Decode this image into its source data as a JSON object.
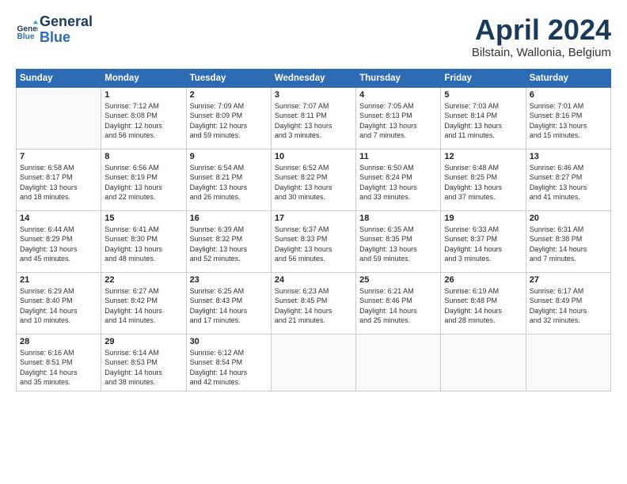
{
  "header": {
    "logo_line1": "General",
    "logo_line2": "Blue",
    "month_title": "April 2024",
    "subtitle": "Bilstain, Wallonia, Belgium"
  },
  "days_of_week": [
    "Sunday",
    "Monday",
    "Tuesday",
    "Wednesday",
    "Thursday",
    "Friday",
    "Saturday"
  ],
  "weeks": [
    [
      {
        "day": "",
        "info": ""
      },
      {
        "day": "1",
        "info": "Sunrise: 7:12 AM\nSunset: 8:08 PM\nDaylight: 12 hours\nand 56 minutes."
      },
      {
        "day": "2",
        "info": "Sunrise: 7:09 AM\nSunset: 8:09 PM\nDaylight: 12 hours\nand 59 minutes."
      },
      {
        "day": "3",
        "info": "Sunrise: 7:07 AM\nSunset: 8:11 PM\nDaylight: 13 hours\nand 3 minutes."
      },
      {
        "day": "4",
        "info": "Sunrise: 7:05 AM\nSunset: 8:13 PM\nDaylight: 13 hours\nand 7 minutes."
      },
      {
        "day": "5",
        "info": "Sunrise: 7:03 AM\nSunset: 8:14 PM\nDaylight: 13 hours\nand 11 minutes."
      },
      {
        "day": "6",
        "info": "Sunrise: 7:01 AM\nSunset: 8:16 PM\nDaylight: 13 hours\nand 15 minutes."
      }
    ],
    [
      {
        "day": "7",
        "info": "Sunrise: 6:58 AM\nSunset: 8:17 PM\nDaylight: 13 hours\nand 18 minutes."
      },
      {
        "day": "8",
        "info": "Sunrise: 6:56 AM\nSunset: 8:19 PM\nDaylight: 13 hours\nand 22 minutes."
      },
      {
        "day": "9",
        "info": "Sunrise: 6:54 AM\nSunset: 8:21 PM\nDaylight: 13 hours\nand 26 minutes."
      },
      {
        "day": "10",
        "info": "Sunrise: 6:52 AM\nSunset: 8:22 PM\nDaylight: 13 hours\nand 30 minutes."
      },
      {
        "day": "11",
        "info": "Sunrise: 6:50 AM\nSunset: 8:24 PM\nDaylight: 13 hours\nand 33 minutes."
      },
      {
        "day": "12",
        "info": "Sunrise: 6:48 AM\nSunset: 8:25 PM\nDaylight: 13 hours\nand 37 minutes."
      },
      {
        "day": "13",
        "info": "Sunrise: 6:46 AM\nSunset: 8:27 PM\nDaylight: 13 hours\nand 41 minutes."
      }
    ],
    [
      {
        "day": "14",
        "info": "Sunrise: 6:44 AM\nSunset: 8:29 PM\nDaylight: 13 hours\nand 45 minutes."
      },
      {
        "day": "15",
        "info": "Sunrise: 6:41 AM\nSunset: 8:30 PM\nDaylight: 13 hours\nand 48 minutes."
      },
      {
        "day": "16",
        "info": "Sunrise: 6:39 AM\nSunset: 8:32 PM\nDaylight: 13 hours\nand 52 minutes."
      },
      {
        "day": "17",
        "info": "Sunrise: 6:37 AM\nSunset: 8:33 PM\nDaylight: 13 hours\nand 56 minutes."
      },
      {
        "day": "18",
        "info": "Sunrise: 6:35 AM\nSunset: 8:35 PM\nDaylight: 13 hours\nand 59 minutes."
      },
      {
        "day": "19",
        "info": "Sunrise: 6:33 AM\nSunset: 8:37 PM\nDaylight: 14 hours\nand 3 minutes."
      },
      {
        "day": "20",
        "info": "Sunrise: 6:31 AM\nSunset: 8:38 PM\nDaylight: 14 hours\nand 7 minutes."
      }
    ],
    [
      {
        "day": "21",
        "info": "Sunrise: 6:29 AM\nSunset: 8:40 PM\nDaylight: 14 hours\nand 10 minutes."
      },
      {
        "day": "22",
        "info": "Sunrise: 6:27 AM\nSunset: 8:42 PM\nDaylight: 14 hours\nand 14 minutes."
      },
      {
        "day": "23",
        "info": "Sunrise: 6:25 AM\nSunset: 8:43 PM\nDaylight: 14 hours\nand 17 minutes."
      },
      {
        "day": "24",
        "info": "Sunrise: 6:23 AM\nSunset: 8:45 PM\nDaylight: 14 hours\nand 21 minutes."
      },
      {
        "day": "25",
        "info": "Sunrise: 6:21 AM\nSunset: 8:46 PM\nDaylight: 14 hours\nand 25 minutes."
      },
      {
        "day": "26",
        "info": "Sunrise: 6:19 AM\nSunset: 8:48 PM\nDaylight: 14 hours\nand 28 minutes."
      },
      {
        "day": "27",
        "info": "Sunrise: 6:17 AM\nSunset: 8:49 PM\nDaylight: 14 hours\nand 32 minutes."
      }
    ],
    [
      {
        "day": "28",
        "info": "Sunrise: 6:16 AM\nSunset: 8:51 PM\nDaylight: 14 hours\nand 35 minutes."
      },
      {
        "day": "29",
        "info": "Sunrise: 6:14 AM\nSunset: 8:53 PM\nDaylight: 14 hours\nand 38 minutes."
      },
      {
        "day": "30",
        "info": "Sunrise: 6:12 AM\nSunset: 8:54 PM\nDaylight: 14 hours\nand 42 minutes."
      },
      {
        "day": "",
        "info": ""
      },
      {
        "day": "",
        "info": ""
      },
      {
        "day": "",
        "info": ""
      },
      {
        "day": "",
        "info": ""
      }
    ]
  ]
}
